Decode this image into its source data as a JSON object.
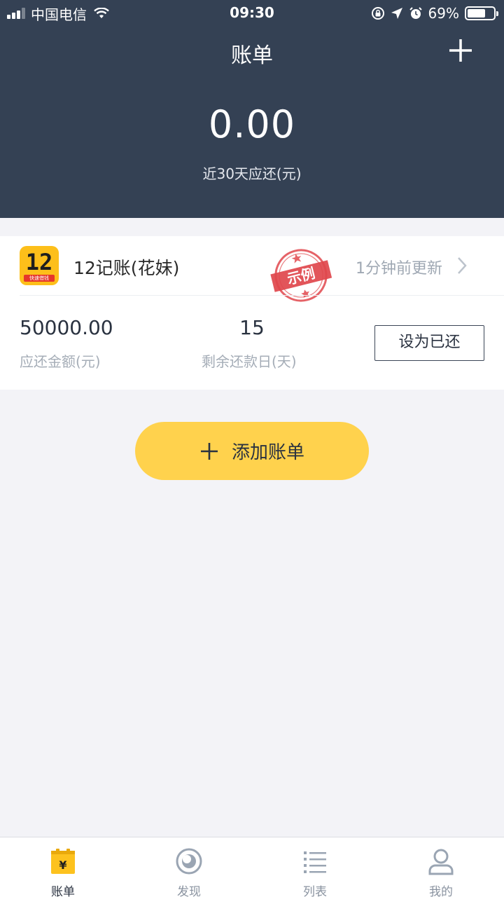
{
  "status_bar": {
    "carrier": "中国电信",
    "time": "09:30",
    "battery": "69%",
    "battery_level": 0.69,
    "icons": [
      "signal-icon",
      "wifi-icon",
      "rotation-lock-icon",
      "location-icon",
      "alarm-icon",
      "battery-icon"
    ]
  },
  "header": {
    "title": "账单",
    "add_icon": "plus-icon",
    "total_amount": "0.00",
    "total_label": "近30天应还(元)"
  },
  "bill_card": {
    "app_logo_number": "12",
    "app_logo_tag": "快速借钱",
    "app_name": "12记账(花妹)",
    "stamp_text": "示例",
    "updated": "1分钟前更新",
    "amount": "50000.00",
    "amount_label": "应还金额(元)",
    "days": "15",
    "days_label": "剩余还款日(天)",
    "action_label": "设为已还"
  },
  "add_bill": {
    "label": "添加账单",
    "icon": "plus-icon"
  },
  "tabs": [
    {
      "label": "账单",
      "icon": "bill-icon",
      "active": true
    },
    {
      "label": "发现",
      "icon": "discover-icon",
      "active": false
    },
    {
      "label": "列表",
      "icon": "list-icon",
      "active": false
    },
    {
      "label": "我的",
      "icon": "profile-icon",
      "active": false
    }
  ],
  "colors": {
    "header_bg": "#344154",
    "accent_yellow": "#ffd24d",
    "stamp_red": "#e0474c",
    "page_bg": "#f3f3f7"
  }
}
